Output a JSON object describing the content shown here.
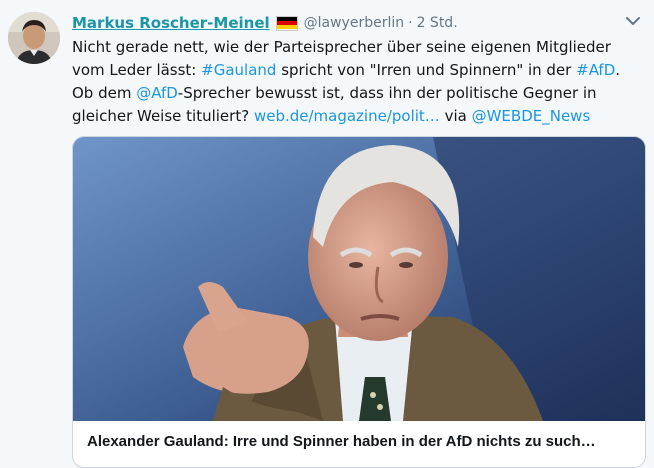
{
  "tweet": {
    "author_name": "Markus Roscher-Meinel",
    "handle": "@lawyerberlin",
    "separator": "·",
    "time": "2 Std.",
    "text_parts": {
      "p1": "Nicht gerade nett, wie der Parteisprecher über seine eigenen Mitglieder vom Leder lässt: ",
      "hashtag1": "#Gauland",
      "p2": " spricht von \"Irren und Spinnern\" in der ",
      "hashtag2": "#AfD",
      "p3": ". Ob dem ",
      "mention1": "@AfD",
      "p4": "-Sprecher bewusst ist, dass ihn der politische Gegner in gleicher Weise tituliert? ",
      "url": "web.de/magazine/polit…",
      "p5": " via ",
      "mention2": "@WEBDE_News"
    },
    "card": {
      "title": "Alexander Gauland: Irre und Spinner haben in der AfD nichts zu such…"
    }
  },
  "icons": {
    "flag": "germany-flag-icon",
    "menu": "chevron-down-icon"
  },
  "colors": {
    "name": "#1b95a8",
    "link": "#1b95e0",
    "muted": "#657786",
    "background": "#f5f8fa"
  }
}
